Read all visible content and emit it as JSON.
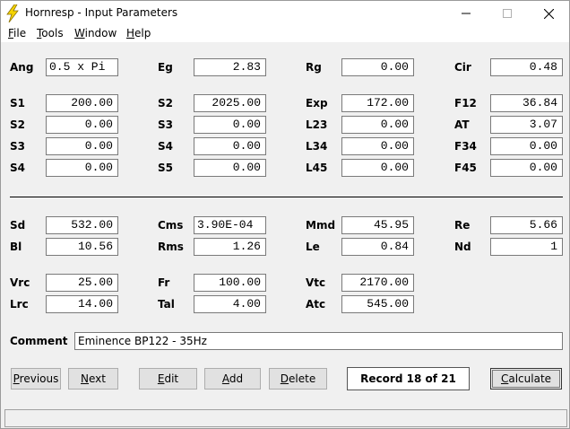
{
  "window": {
    "title": "Hornresp - Input Parameters"
  },
  "menu": [
    {
      "label": "File",
      "accel": "F",
      "rest": "ile"
    },
    {
      "label": "Tools",
      "accel": "T",
      "rest": "ools"
    },
    {
      "label": "Window",
      "accel": "W",
      "rest": "indow"
    },
    {
      "label": "Help",
      "accel": "H",
      "rest": "elp"
    }
  ],
  "fields": {
    "ang": {
      "label": "Ang",
      "value": "0.5 x Pi"
    },
    "eg": {
      "label": "Eg",
      "value": "2.83"
    },
    "rg": {
      "label": "Rg",
      "value": "0.00"
    },
    "cir": {
      "label": "Cir",
      "value": "0.48"
    },
    "s1": {
      "label": "S1",
      "value": "200.00"
    },
    "s2": {
      "label": "S2",
      "value": "2025.00"
    },
    "exp": {
      "label": "Exp",
      "value": "172.00"
    },
    "f12": {
      "label": "F12",
      "value": "36.84"
    },
    "s2b": {
      "label": "S2",
      "value": "0.00"
    },
    "s3": {
      "label": "S3",
      "value": "0.00"
    },
    "l23": {
      "label": "L23",
      "value": "0.00"
    },
    "at": {
      "label": "AT",
      "value": "3.07"
    },
    "s3b": {
      "label": "S3",
      "value": "0.00"
    },
    "s4": {
      "label": "S4",
      "value": "0.00"
    },
    "l34": {
      "label": "L34",
      "value": "0.00"
    },
    "f34": {
      "label": "F34",
      "value": "0.00"
    },
    "s4b": {
      "label": "S4",
      "value": "0.00"
    },
    "s5": {
      "label": "S5",
      "value": "0.00"
    },
    "l45": {
      "label": "L45",
      "value": "0.00"
    },
    "f45": {
      "label": "F45",
      "value": "0.00"
    },
    "sd": {
      "label": "Sd",
      "value": "532.00"
    },
    "cms": {
      "label": "Cms",
      "value": "3.90E-04"
    },
    "mmd": {
      "label": "Mmd",
      "value": "45.95"
    },
    "re": {
      "label": "Re",
      "value": "5.66"
    },
    "bl": {
      "label": "Bl",
      "value": "10.56"
    },
    "rms": {
      "label": "Rms",
      "value": "1.26"
    },
    "le": {
      "label": "Le",
      "value": "0.84"
    },
    "nd": {
      "label": "Nd",
      "value": "1"
    },
    "vrc": {
      "label": "Vrc",
      "value": "25.00"
    },
    "fr": {
      "label": "Fr",
      "value": "100.00"
    },
    "vtc": {
      "label": "Vtc",
      "value": "2170.00"
    },
    "lrc": {
      "label": "Lrc",
      "value": "14.00"
    },
    "tal": {
      "label": "Tal",
      "value": "4.00"
    },
    "atc": {
      "label": "Atc",
      "value": "545.00"
    }
  },
  "comment": {
    "label": "Comment",
    "value": "Eminence BP122 - 35Hz"
  },
  "buttons": {
    "previous": {
      "accel": "P",
      "rest": "revious"
    },
    "next": {
      "accel": "N",
      "rest": "ext"
    },
    "edit": {
      "accel": "E",
      "rest": "dit"
    },
    "add": {
      "accel": "A",
      "rest": "dd"
    },
    "delete": {
      "accel": "D",
      "rest": "elete"
    },
    "calculate": {
      "accel": "C",
      "rest": "alculate"
    }
  },
  "record": "Record 18 of 21",
  "icons": {
    "app": "lightning-icon",
    "minimize": "minimize-icon",
    "maximize": "maximize-icon",
    "close": "close-icon"
  }
}
